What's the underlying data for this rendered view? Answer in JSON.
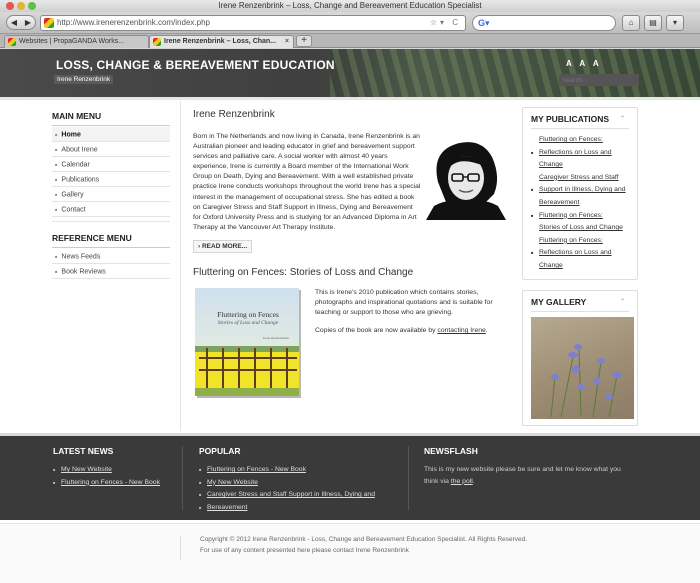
{
  "browser": {
    "window_title": "Irene Renzenbrink – Loss, Change and Bereavement Education Specialist",
    "url": "http://www.irenerenzenbrink.com/index.php",
    "tabs": [
      {
        "label": "Websites | PropaGANDA Works..."
      },
      {
        "label": "Irene Renzenbrink – Loss, Chan..."
      }
    ]
  },
  "header": {
    "title": "LOSS, CHANGE & BEREAVEMENT EDUCATION",
    "subtitle": "Irene Renzenbrink",
    "font_size_controls": "A A A",
    "search_placeholder": "search..."
  },
  "main_menu": {
    "heading": "MAIN MENU",
    "items": [
      "Home",
      "About Irene",
      "Calendar",
      "Publications",
      "Gallery",
      "Contact"
    ]
  },
  "reference_menu": {
    "heading": "REFERENCE MENU",
    "items": [
      "News Feeds",
      "Book Reviews"
    ]
  },
  "article1": {
    "title": "Irene Renzenbrink",
    "body": "Born in The Netherlands and now living in Canada, Irene Renzenbrink is an Australian pioneer and leading educator in grief and bereavement support services and palliative care. A social worker with almost 40 years experience, Irene is currently a Board member of the International Work Group on Death, Dying and Bereavement. With a well established private practice Irene conducts workshops throughout the world Irene has a special interest in the management of occupational stress. She has edited a book on Caregiver Stress and Staff Support in Illness, Dying and Bereavement for Oxford University Press and is studying for an Advanced Diploma in Art Therapy at the Vancouver Art Therapy Institute.",
    "read_more": "READ MORE..."
  },
  "article2": {
    "title": "Fluttering on Fences: Stories of Loss and Change",
    "p1": "This is Irene's 2010 publication which contains stories, photographs and inspirational quotations and is suitable for teaching or support to those who are grieving.",
    "p2_prefix": "Copies of the book are now available by ",
    "p2_link": "contacting Irene",
    "p2_suffix": ".",
    "book_title": "Fluttering on Fences",
    "book_subtitle": "Stories of Loss and Change",
    "book_author": "Irene Renzenbrink"
  },
  "publications": {
    "heading": "MY PUBLICATIONS",
    "items": [
      {
        "text": "Fluttering on Fences:",
        "bullet": false
      },
      {
        "text": "Reflections on Loss and",
        "bullet": true
      },
      {
        "text": "Change",
        "bullet": false
      },
      {
        "text": "Caregiver Stress and Staff",
        "bullet": false
      },
      {
        "text": "Support in Illness, Dying and",
        "bullet": true
      },
      {
        "text": "Bereavement",
        "bullet": false
      },
      {
        "text": "Fluttering on Fences:",
        "bullet": true
      },
      {
        "text": "Stories of Loss and Change",
        "bullet": false
      },
      {
        "text": "Fluttering on Fences:",
        "bullet": false
      },
      {
        "text": "Reflections on Loss and",
        "bullet": true
      },
      {
        "text": "Change",
        "bullet": false
      }
    ]
  },
  "gallery": {
    "heading": "MY GALLERY"
  },
  "footer": {
    "latest_news": {
      "heading": "LATEST NEWS",
      "items": [
        "My New Website",
        "Fluttering on Fences - New Book"
      ]
    },
    "popular": {
      "heading": "POPULAR",
      "items": [
        "Fluttering on Fences - New Book",
        "My New Website",
        "Caregiver Stress and Staff Support in Illness, Dying and",
        "Bereavement"
      ]
    },
    "newsflash": {
      "heading": "NEWSFLASH",
      "text": "This is my new website please be sure and let me know what you think via ",
      "link": "the poll",
      "suffix": "."
    }
  },
  "copyright": {
    "line1": "Copyright © 2012 Irene Renzenbrink - Loss, Change and Bereavement Education Specialist. All Rights Reserved.",
    "line2": "For use of any content presented here please contact Irene Renzenbrink"
  }
}
